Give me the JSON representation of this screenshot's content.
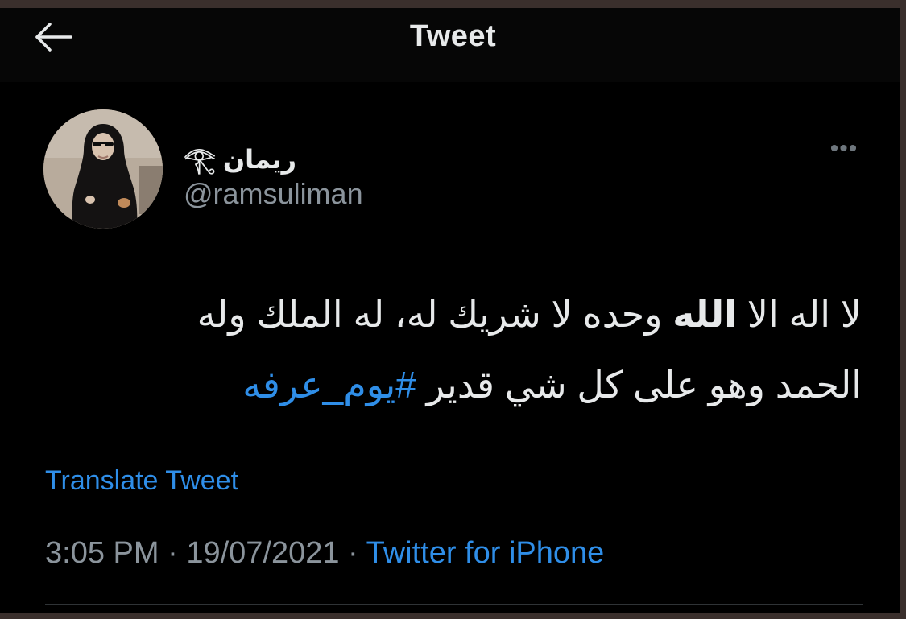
{
  "header": {
    "title": "Tweet",
    "back_icon": "arrow-left-icon"
  },
  "author": {
    "display_name": "ريمان 𓂀",
    "handle": "@ramsuliman",
    "avatar_icon": "profile-photo"
  },
  "more_icon": "ellipsis-icon",
  "more_label": "•••",
  "tweet": {
    "line1_start": "لا اله الا ",
    "line1_bold": "الله",
    "line1_end": " وحده لا شريك له، له الملك وله",
    "line2_text": "الحمد وهو على كل شي قدير ",
    "hashtag": "#يوم_عرفه"
  },
  "translate_label": "Translate Tweet",
  "meta": {
    "time": "3:05 PM",
    "separator": " · ",
    "date": "19/07/2021",
    "source": "Twitter for iPhone"
  },
  "colors": {
    "background": "#000000",
    "text": "#e7e9ea",
    "secondary": "#8b949c",
    "link": "#2f8ee8"
  }
}
